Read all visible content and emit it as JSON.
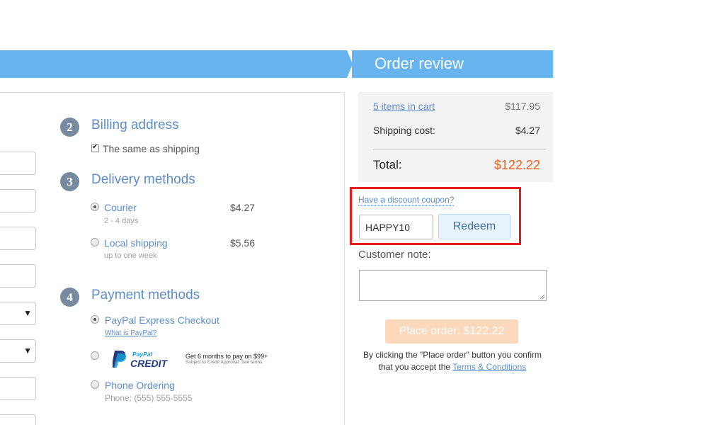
{
  "banner": {
    "title": "Order review"
  },
  "billing": {
    "step_number": "2",
    "title": "Billing address",
    "same_as_shipping_label": "The same as shipping",
    "same_as_shipping_checked": true
  },
  "delivery": {
    "step_number": "3",
    "title": "Delivery methods",
    "options": [
      {
        "label": "Courier",
        "sub": "2 - 4 days",
        "price": "$4.27",
        "selected": true
      },
      {
        "label": "Local shipping",
        "sub": "up to one week",
        "price": "$5.56",
        "selected": false
      }
    ]
  },
  "payment": {
    "step_number": "4",
    "title": "Payment methods",
    "options": [
      {
        "label": "PayPal Express Checkout",
        "link": "What is PayPal?",
        "selected": true
      },
      {
        "label": "PayPal Credit",
        "logo_text_top": "PayPal",
        "logo_text_bottom": "CREDIT",
        "offer": "Get 6 months to pay on $99+",
        "offer_sub": "Subject to Credit Approval. See terms",
        "selected": false
      },
      {
        "label": "Phone Ordering",
        "sub": "Phone: (555) 555-5555",
        "selected": false
      }
    ]
  },
  "summary": {
    "cart_link": "5 items in cart",
    "cart_amount": "$117.95",
    "shipping_label": "Shipping cost:",
    "shipping_amount": "$4.27",
    "total_label": "Total:",
    "total_amount": "$122.22"
  },
  "coupon": {
    "link": "Have a discount coupon?",
    "value": "HAPPY10",
    "redeem_label": "Redeem"
  },
  "note": {
    "label": "Customer note:",
    "value": ""
  },
  "place_order": {
    "label": "Place order: $122.22",
    "disclaimer_before": "By clicking the \"Place order\" button you confirm that you accept the ",
    "terms_link": "Terms & Conditions"
  },
  "colors": {
    "banner": "#68b4ee",
    "link": "#5e8ec7",
    "total": "#f05d1e",
    "highlight": "#e51c1c",
    "place_order_bg": "#fcd9bc"
  }
}
